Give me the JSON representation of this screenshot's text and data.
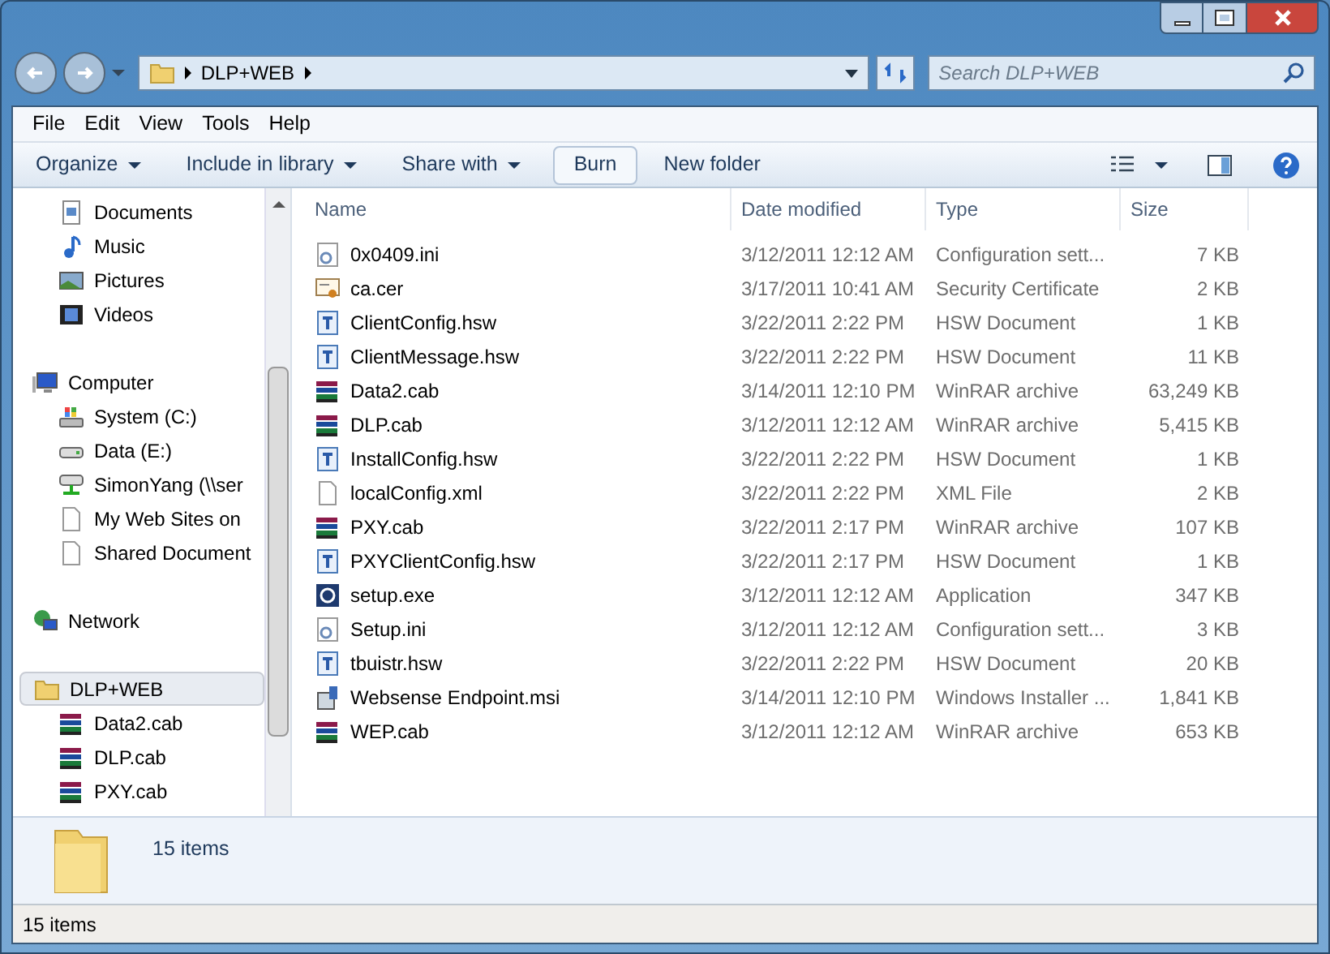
{
  "address": {
    "crumbs": [
      "DLP+WEB"
    ]
  },
  "search": {
    "placeholder": "Search DLP+WEB"
  },
  "menu": [
    "File",
    "Edit",
    "View",
    "Tools",
    "Help"
  ],
  "toolbar": [
    {
      "label": "Organize",
      "kind": "dropdown"
    },
    {
      "label": "Include in library",
      "kind": "dropdown"
    },
    {
      "label": "Share with",
      "kind": "dropdown"
    },
    {
      "label": "Burn",
      "kind": "button"
    },
    {
      "label": "New folder",
      "kind": "plain"
    }
  ],
  "sidebar": {
    "items": [
      {
        "label": "Documents",
        "kind": "documents",
        "selected": false
      },
      {
        "label": "Music",
        "kind": "music",
        "selected": false
      },
      {
        "label": "Pictures",
        "kind": "pictures",
        "selected": false
      },
      {
        "label": "Videos",
        "kind": "videos",
        "selected": false
      },
      {
        "label": "Computer",
        "kind": "computer",
        "selected": false,
        "children": [
          {
            "label": "System (C:)",
            "kind": "system-drive",
            "selected": false
          },
          {
            "label": "Data (E:)",
            "kind": "drive",
            "selected": false
          },
          {
            "label": "SimonYang (\\\\ser",
            "kind": "network-drive",
            "selected": false
          },
          {
            "label": "My Web Sites on",
            "kind": "page",
            "selected": false
          },
          {
            "label": "Shared Document",
            "kind": "page",
            "selected": false
          }
        ]
      },
      {
        "label": "Network",
        "kind": "network",
        "selected": false
      },
      {
        "label": "DLP+WEB",
        "kind": "folder",
        "selected": true,
        "children": [
          {
            "label": "Data2.cab",
            "kind": "cab",
            "selected": false
          },
          {
            "label": "DLP.cab",
            "kind": "cab",
            "selected": false
          },
          {
            "label": "PXY.cab",
            "kind": "cab",
            "selected": false
          }
        ]
      }
    ]
  },
  "table": {
    "columns": [
      "Name",
      "Date modified",
      "Type",
      "Size"
    ],
    "rows": [
      {
        "name": "0x0409.ini",
        "kind": "ini",
        "date": "3/12/2011 12:12 AM",
        "type": "Configuration sett...",
        "size": "7 KB"
      },
      {
        "name": "ca.cer",
        "kind": "cer",
        "date": "3/17/2011 10:41 AM",
        "type": "Security Certificate",
        "size": "2 KB"
      },
      {
        "name": "ClientConfig.hsw",
        "kind": "hsw",
        "date": "3/22/2011 2:22 PM",
        "type": "HSW Document",
        "size": "1 KB"
      },
      {
        "name": "ClientMessage.hsw",
        "kind": "hsw",
        "date": "3/22/2011 2:22 PM",
        "type": "HSW Document",
        "size": "11 KB"
      },
      {
        "name": "Data2.cab",
        "kind": "cab",
        "date": "3/14/2011 12:10 PM",
        "type": "WinRAR archive",
        "size": "63,249 KB"
      },
      {
        "name": "DLP.cab",
        "kind": "cab",
        "date": "3/12/2011 12:12 AM",
        "type": "WinRAR archive",
        "size": "5,415 KB"
      },
      {
        "name": "InstallConfig.hsw",
        "kind": "hsw",
        "date": "3/22/2011 2:22 PM",
        "type": "HSW Document",
        "size": "1 KB"
      },
      {
        "name": "localConfig.xml",
        "kind": "xml",
        "date": "3/22/2011 2:22 PM",
        "type": "XML File",
        "size": "2 KB"
      },
      {
        "name": "PXY.cab",
        "kind": "cab",
        "date": "3/22/2011 2:17 PM",
        "type": "WinRAR archive",
        "size": "107 KB"
      },
      {
        "name": "PXYClientConfig.hsw",
        "kind": "hsw",
        "date": "3/22/2011 2:17 PM",
        "type": "HSW Document",
        "size": "1 KB"
      },
      {
        "name": "setup.exe",
        "kind": "exe",
        "date": "3/12/2011 12:12 AM",
        "type": "Application",
        "size": "347 KB"
      },
      {
        "name": "Setup.ini",
        "kind": "ini",
        "date": "3/12/2011 12:12 AM",
        "type": "Configuration sett...",
        "size": "3 KB"
      },
      {
        "name": "tbuistr.hsw",
        "kind": "hsw",
        "date": "3/22/2011 2:22 PM",
        "type": "HSW Document",
        "size": "20 KB"
      },
      {
        "name": "Websense Endpoint.msi",
        "kind": "msi",
        "date": "3/14/2011 12:10 PM",
        "type": "Windows Installer ...",
        "size": "1,841 KB"
      },
      {
        "name": "WEP.cab",
        "kind": "cab",
        "date": "3/12/2011 12:12 AM",
        "type": "WinRAR archive",
        "size": "653 KB"
      }
    ]
  },
  "details": {
    "count": "15 items"
  },
  "status_bar": {
    "text": "15 items"
  }
}
